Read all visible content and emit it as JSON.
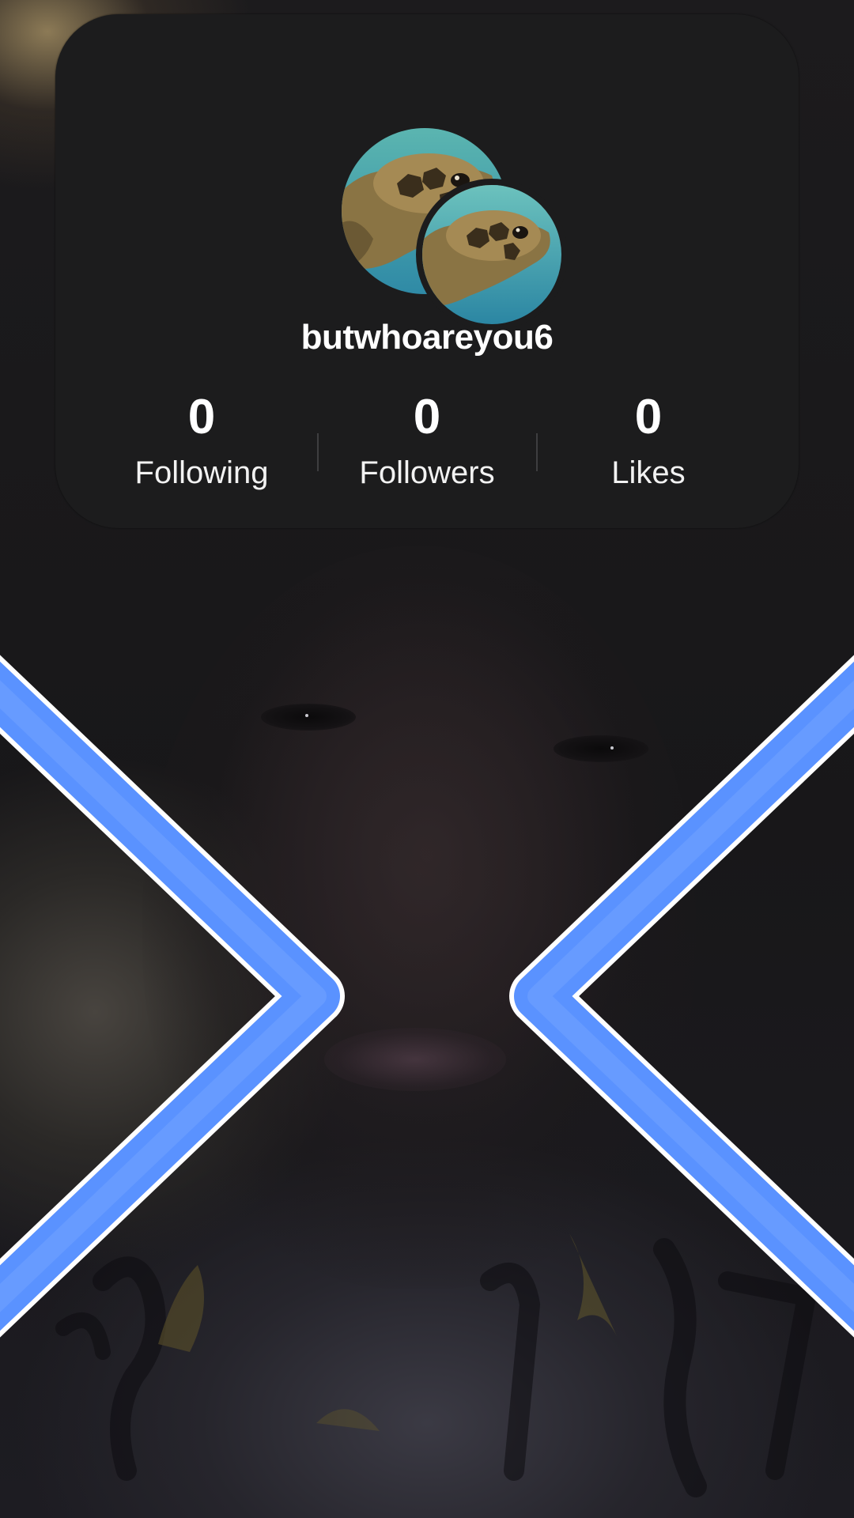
{
  "profile": {
    "username": "butwhoareyou6",
    "avatar_subject": "sea-turtle-photo",
    "stats": [
      {
        "count": "0",
        "label": "Following"
      },
      {
        "count": "0",
        "label": "Followers"
      },
      {
        "count": "0",
        "label": "Likes"
      }
    ]
  },
  "navigation": {
    "previous_icon": "chevron-right-icon",
    "next_icon": "chevron-left-icon"
  },
  "colors": {
    "card_background": "#1c1c1d",
    "chevron_fill": "#5a92ff",
    "chevron_outline": "#ffffff",
    "text": "#ffffff"
  }
}
